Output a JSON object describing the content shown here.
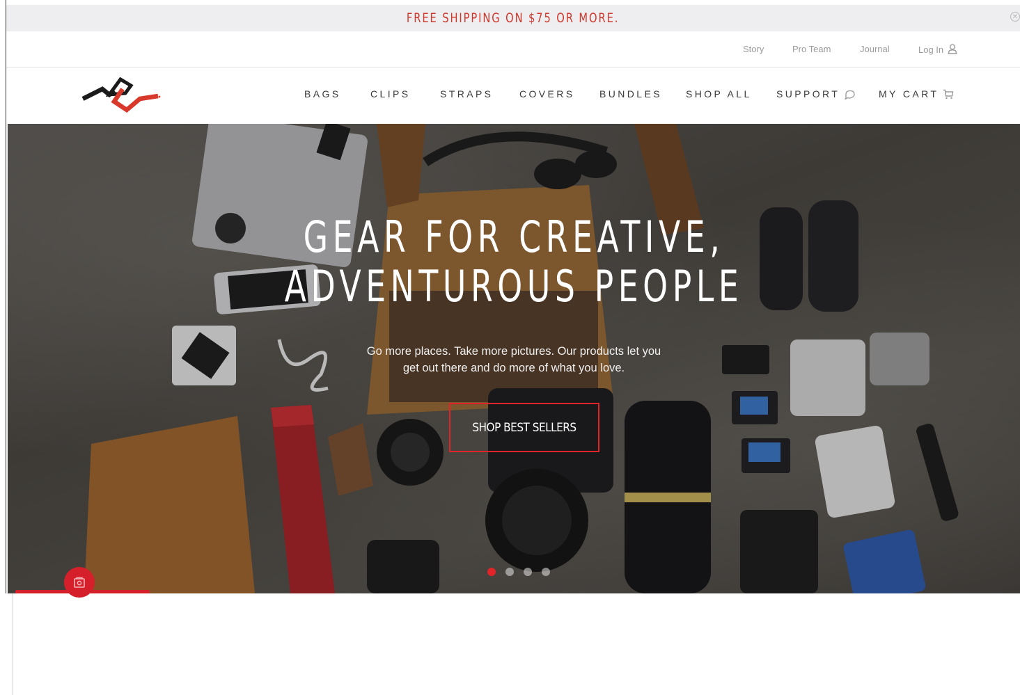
{
  "promo": {
    "text": "FREE SHIPPING ON $75 OR MORE.",
    "close_icon": "close-circle-icon"
  },
  "utility_nav": {
    "links": [
      "Story",
      "Pro Team",
      "Journal",
      "Log In"
    ],
    "login_icon": "user-icon"
  },
  "header": {
    "logo": "peak-design-logo",
    "nav": [
      "BAGS",
      "CLIPS",
      "STRAPS",
      "COVERS",
      "BUNDLES",
      "SHOP ALL",
      "SUPPORT",
      "MY CART"
    ],
    "support_icon": "chat-bubble-icon",
    "cart_icon": "cart-icon"
  },
  "hero": {
    "title_line1": "GEAR FOR CREATIVE,",
    "title_line2": "ADVENTUROUS PEOPLE",
    "subtitle_line1": "Go more places. Take more pictures. Our products let you",
    "subtitle_line2": "get out there and do more of what you love.",
    "cta": "SHOP BEST SELLERS",
    "slides": 4,
    "active_slide": 1
  },
  "colors": {
    "accent": "#e0242a",
    "promo_text": "#d0382c",
    "promo_bg": "#eeeef0"
  },
  "widget": {
    "icon": "rewards-icon"
  }
}
